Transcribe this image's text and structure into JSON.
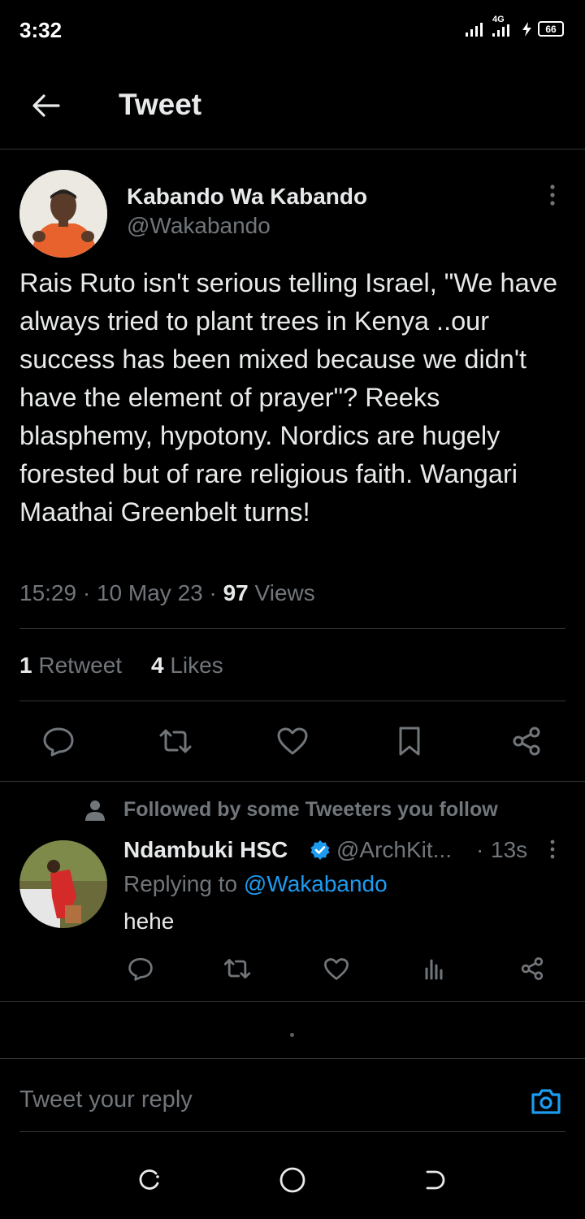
{
  "status_bar": {
    "time": "3:32",
    "network": "4G",
    "battery": "66"
  },
  "header": {
    "title": "Tweet"
  },
  "tweet": {
    "author_name": "Kabando Wa Kabando",
    "author_handle": "@Wakabando",
    "body": "Rais Ruto isn't serious telling Israel, \"We have always tried to plant trees in Kenya ..our success has been mixed because we didn't have the element of prayer\"? Reeks blasphemy, hypotony. Nordics are hugely forested but of rare religious faith. Wangari Maathai Greenbelt turns!",
    "time": "15:29",
    "date": "10 May 23",
    "views_count": "97",
    "views_label": "Views",
    "retweets_count": "1",
    "retweets_label": "Retweet",
    "likes_count": "4",
    "likes_label": "Likes"
  },
  "reply": {
    "context": "Followed by some Tweeters you follow",
    "author_name": "Ndambuki HSC",
    "author_handle": "@ArchKit...",
    "time_ago": "13s",
    "replying_label": "Replying to",
    "replying_to": "@Wakabando",
    "text": "hehe"
  },
  "composer": {
    "placeholder": "Tweet your reply"
  },
  "colors": {
    "background": "#000000",
    "text_primary": "#e7e9ea",
    "text_muted": "#71767b",
    "accent_blue": "#1d9bf0",
    "divider": "#2f3336"
  }
}
